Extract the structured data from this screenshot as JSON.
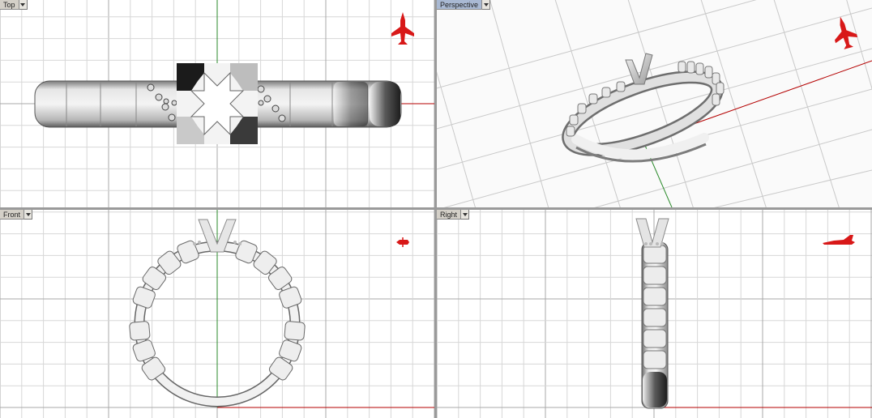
{
  "viewports": [
    {
      "id": "top",
      "label": "Top",
      "active": false
    },
    {
      "id": "perspective",
      "label": "Perspective",
      "active": true
    },
    {
      "id": "front",
      "label": "Front",
      "active": false
    },
    {
      "id": "right",
      "label": "Right",
      "active": false
    }
  ],
  "icons": {
    "view_menu": "chevron-down-icon",
    "orientation": "jet-orientation-icon"
  },
  "colors": {
    "background": "#ffffff",
    "grid_minor": "#d7d7d7",
    "grid_major": "#a8a8a8",
    "axis_x": "#b40000",
    "axis_y": "#2a8a2a",
    "orientation_icon": "#d81818",
    "label_bg": "#d4d0c8",
    "label_active_bg": "#a9b9d3"
  }
}
